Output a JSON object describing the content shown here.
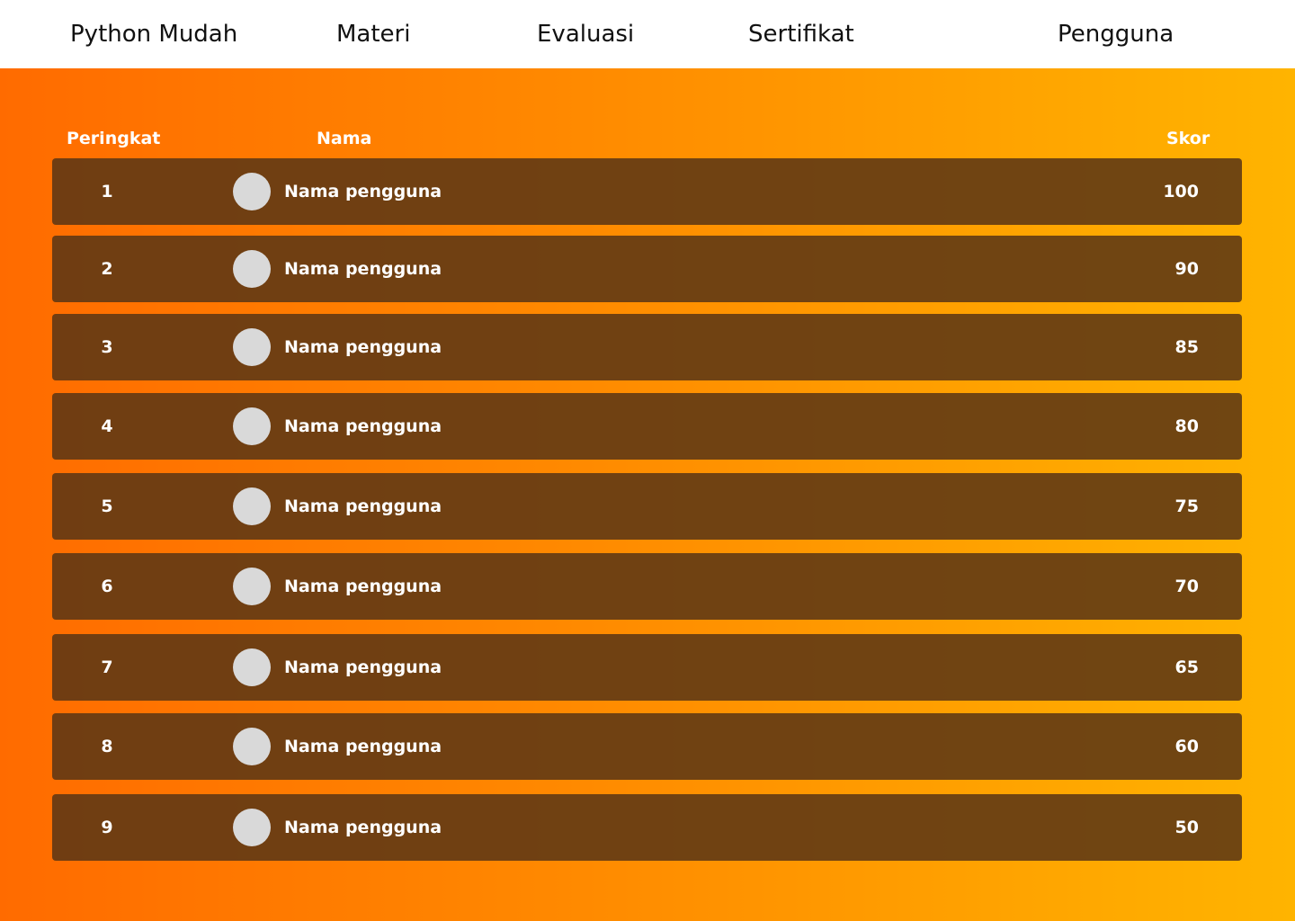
{
  "nav": {
    "brand": "Python Mudah",
    "materi": "Materi",
    "evaluasi": "Evaluasi",
    "sertifikat": "Sertifikat",
    "pengguna": "Pengguna"
  },
  "leaderboard": {
    "headers": {
      "rank": "Peringkat",
      "name": "Nama",
      "score": "Skor"
    },
    "rows": [
      {
        "rank": "1",
        "name": "Nama pengguna",
        "score": "100"
      },
      {
        "rank": "2",
        "name": "Nama pengguna",
        "score": "90"
      },
      {
        "rank": "3",
        "name": "Nama pengguna",
        "score": "85"
      },
      {
        "rank": "4",
        "name": "Nama pengguna",
        "score": "80"
      },
      {
        "rank": "5",
        "name": "Nama pengguna",
        "score": "75"
      },
      {
        "rank": "6",
        "name": "Nama pengguna",
        "score": "70"
      },
      {
        "rank": "7",
        "name": "Nama pengguna",
        "score": "65"
      },
      {
        "rank": "8",
        "name": "Nama pengguna",
        "score": "60"
      },
      {
        "rank": "9",
        "name": "Nama pengguna",
        "score": "50"
      }
    ]
  },
  "colors": {
    "gradient_start": "#ff6b00",
    "gradient_end": "#ffb400",
    "row_bg": "#5c3714",
    "avatar": "#d9d9d9",
    "nav_bg": "#ffffff"
  }
}
